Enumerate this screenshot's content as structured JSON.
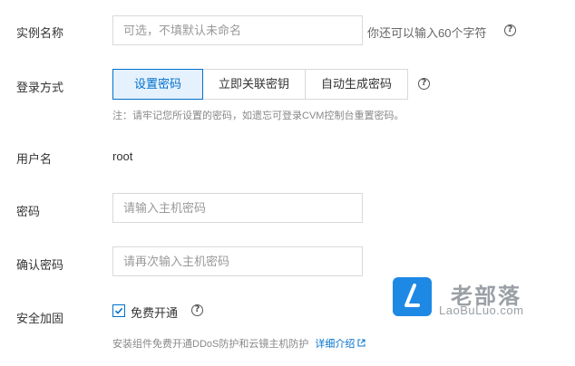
{
  "instance_name": {
    "label": "实例名称",
    "placeholder": "可选，不填默认未命名",
    "hint": "你还可以输入60个字符"
  },
  "login_method": {
    "label": "登录方式",
    "options": [
      "设置密码",
      "立即关联密钥",
      "自动生成密码"
    ],
    "selected": "设置密码",
    "note": "注：请牢记您所设置的密码，如遗忘可登录CVM控制台重置密码。"
  },
  "username": {
    "label": "用户名",
    "value": "root"
  },
  "password": {
    "label": "密码",
    "placeholder": "请输入主机密码"
  },
  "confirm_password": {
    "label": "确认密码",
    "placeholder": "请再次输入主机密码"
  },
  "security": {
    "label": "安全加固",
    "checkbox_label": "免费开通",
    "checked": true,
    "note": "安装组件免费开通DDoS防护和云镜主机防护",
    "link": "详细介绍"
  },
  "watermark": {
    "title": "老部落",
    "subtitle": "LaoBuLuo.com",
    "color": "#1e88e5"
  },
  "colors": {
    "accent": "#0070cc",
    "active_bg": "#e5f1fd"
  }
}
